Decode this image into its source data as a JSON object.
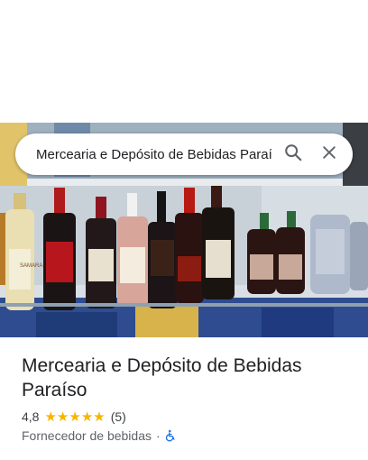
{
  "search": {
    "query": "Mercearia e Depósito de Bebidas Paraíso"
  },
  "photo": {
    "label_samara": "SAMARA"
  },
  "place": {
    "name": "Mercearia e Depósito de Bebidas Paraíso",
    "rating": "4,8",
    "stars": 5,
    "review_count": "(5)",
    "category": "Fornecedor de bebidas",
    "separator": "·"
  },
  "colors": {
    "star": "#f6b400",
    "accessible_icon": "#1a73e8"
  }
}
